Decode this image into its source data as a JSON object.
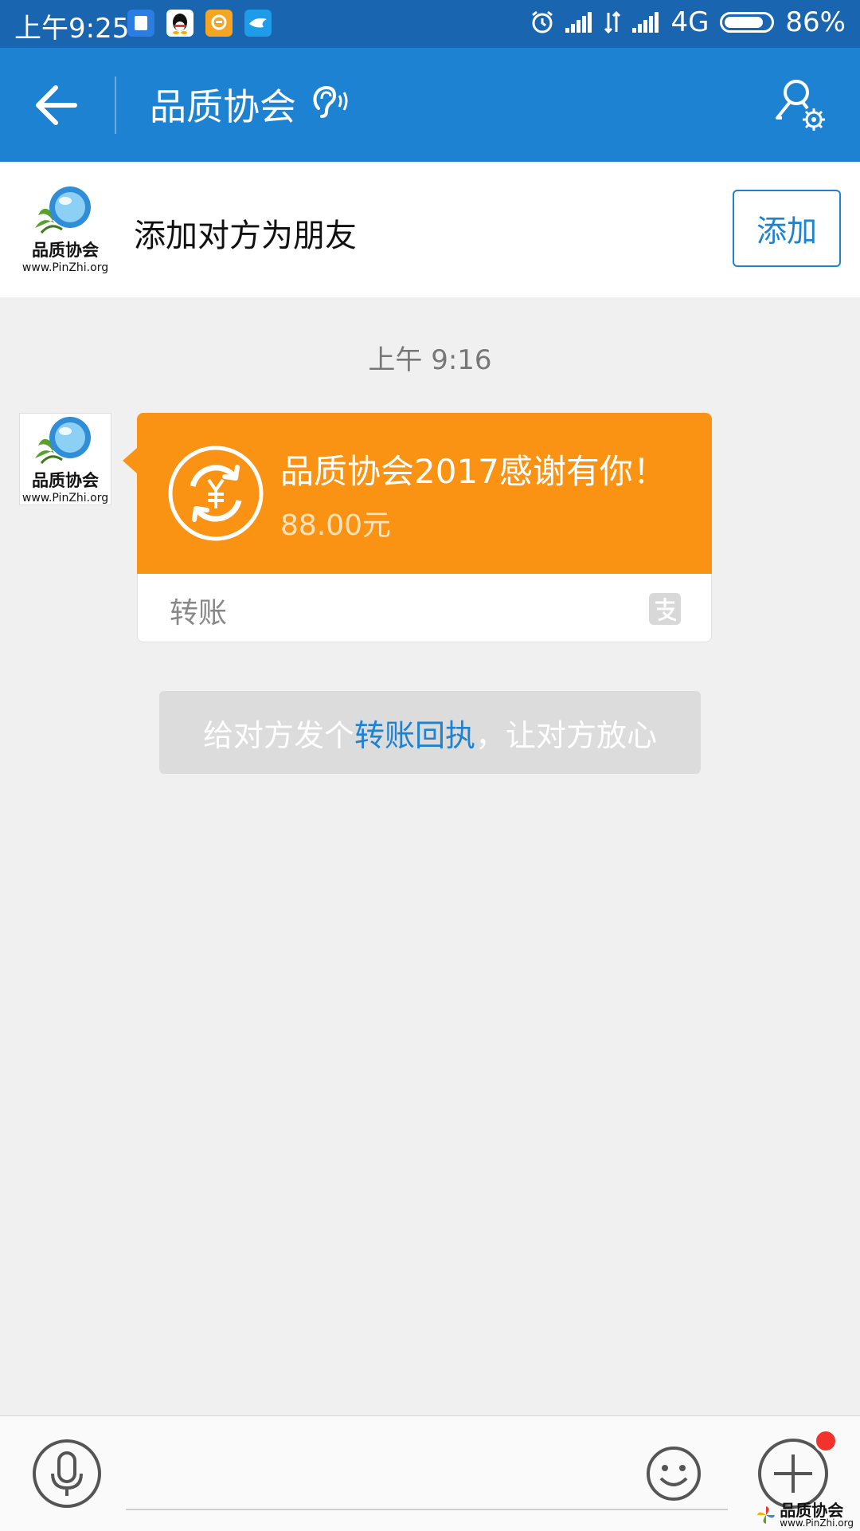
{
  "status_bar": {
    "time": "上午9:25",
    "network": "4G",
    "battery": "86%",
    "battery_level": 0.86,
    "app_icons": [
      "notes-icon",
      "qq-icon",
      "chat-bubble-icon",
      "bird-icon"
    ]
  },
  "header": {
    "title": "品质协会",
    "back_icon": "arrow-left-icon",
    "mode_icon": "ear-icon",
    "profile_icon": "user-settings-icon"
  },
  "add_friend": {
    "logo_text": "品质协会",
    "logo_url": "www.PinZhi.org",
    "prompt": "添加对方为朋友",
    "button_label": "添加"
  },
  "chat": {
    "timestamp": "上午 9:16",
    "avatar_text": "品质协会",
    "avatar_url": "www.PinZhi.org",
    "transfer": {
      "title": "品质协会2017感谢有你！",
      "amount": "88.00元",
      "label": "转账",
      "icon": "yuan-transfer-icon",
      "brand_icon": "alipay-icon",
      "color": "#fa9314"
    },
    "receipt_tip": {
      "before": "给对方发个",
      "link": "转账回执",
      "after": "，让对方放心"
    }
  },
  "input_bar": {
    "mic_icon": "microphone-icon",
    "emoji_icon": "smiley-icon",
    "plus_icon": "plus-icon",
    "has_notification": true
  },
  "watermark": {
    "text": "品质协会",
    "url": "www.PinZhi.org"
  },
  "colors": {
    "status_bar": "#1a65b0",
    "header": "#1d82d2",
    "accent": "#1d82d2",
    "transfer_orange": "#fa9314",
    "notification_red": "#f2332b"
  }
}
